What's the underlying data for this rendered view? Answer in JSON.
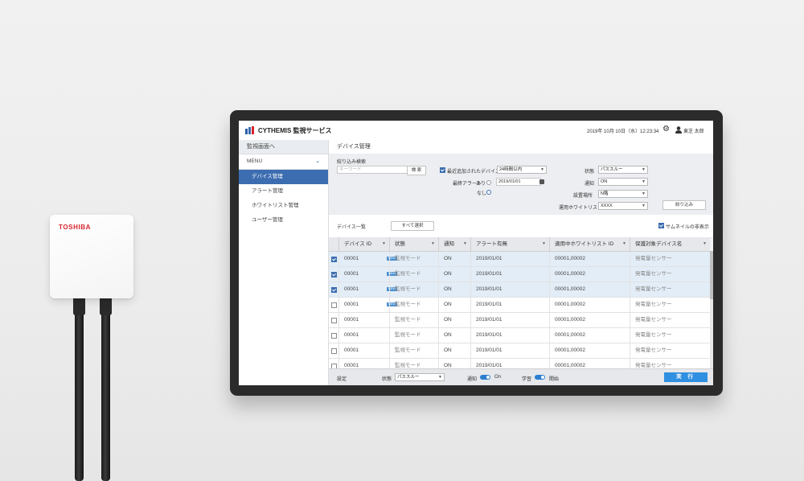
{
  "device": {
    "brand": "TOSHIBA"
  },
  "header": {
    "title": "CYTHEMIS 監視サービス",
    "datetime": "2019年 10月 10日（水）12:23:34",
    "user": "東芝 太郎"
  },
  "sidebar": {
    "back": "監視画面へ",
    "menu_label": "MENU",
    "items": [
      {
        "label": "デバイス管理"
      },
      {
        "label": "アラート管理"
      },
      {
        "label": "ホワイトリスト管理"
      },
      {
        "label": "ユーザー管理"
      }
    ]
  },
  "main": {
    "page_title": "デバイス管理",
    "filter": {
      "title": "絞り込み検索",
      "keyword_placeholder": "キーワード",
      "search_label": "検 索",
      "recent_label": "最近追加されたデバイス",
      "recent_value": "24時間以内",
      "last_alert_label": "最終アラート",
      "alert_yes": "あり",
      "alert_date": "2019/01/01",
      "alert_no": "なし",
      "state_label": "状態",
      "state_value": "パススルー",
      "notify_label": "通知",
      "notify_value": "ON",
      "location_label": "設置場所",
      "location_value": "N階",
      "whitelist_label": "運用ホワイトリスト",
      "whitelist_value": "XXXX",
      "apply_label": "絞り込み"
    },
    "list": {
      "title": "デバイス一覧",
      "select_all": "すべて選択",
      "thumb_hide": "サムネイルの非表示"
    },
    "table": {
      "columns": [
        "デバイス ID",
        "状態",
        "通知",
        "アラート有無",
        "適用中ホワイトリスト ID",
        "保護対象デバイス名"
      ],
      "rows": [
        {
          "checked": true,
          "id": "00001",
          "new": "NEW",
          "state": "監視モード",
          "notify": "ON",
          "alert": "2019/01/01",
          "whitelist": "00001,00002",
          "name": "発電量センサー"
        },
        {
          "checked": true,
          "id": "00001",
          "new": "NEW",
          "state": "監視モード",
          "notify": "ON",
          "alert": "2019/01/01",
          "whitelist": "00001,00002",
          "name": "発電量センサー"
        },
        {
          "checked": true,
          "id": "00001",
          "new": "NEW",
          "state": "監視モード",
          "notify": "ON",
          "alert": "2019/01/01",
          "whitelist": "00001,00002",
          "name": "発電量センサー"
        },
        {
          "checked": false,
          "id": "00001",
          "new": "NEW",
          "state": "監視モード",
          "notify": "ON",
          "alert": "2019/01/01",
          "whitelist": "00001,00002",
          "name": "発電量センサー"
        },
        {
          "checked": false,
          "id": "00001",
          "new": "",
          "state": "監視モード",
          "notify": "ON",
          "alert": "2019/01/01",
          "whitelist": "00001,00002",
          "name": "発電量センサー"
        },
        {
          "checked": false,
          "id": "00001",
          "new": "",
          "state": "監視モード",
          "notify": "ON",
          "alert": "2019/01/01",
          "whitelist": "00001,00002",
          "name": "発電量センサー"
        },
        {
          "checked": false,
          "id": "00001",
          "new": "",
          "state": "監視モード",
          "notify": "ON",
          "alert": "2019/01/01",
          "whitelist": "00001,00002",
          "name": "発電量センサー"
        },
        {
          "checked": false,
          "id": "00001",
          "new": "",
          "state": "監視モード",
          "notify": "ON",
          "alert": "2019/01/01",
          "whitelist": "00001,00002",
          "name": "発電量センサー"
        }
      ]
    },
    "footer": {
      "settings_label": "設定",
      "state_label": "状態",
      "state_value": "パススルー",
      "notify_label": "通知",
      "notify_state": "On",
      "learn_label": "学習",
      "learn_state": "開始",
      "execute_label": "実 行"
    }
  },
  "colors": {
    "accent": "#3c6db0",
    "execute": "#2f8fe0",
    "brand_red": "#d9232d"
  },
  "icons": {
    "settings": "gear-icon",
    "user": "user-icon",
    "logo": "cythemis-logo-icon"
  }
}
